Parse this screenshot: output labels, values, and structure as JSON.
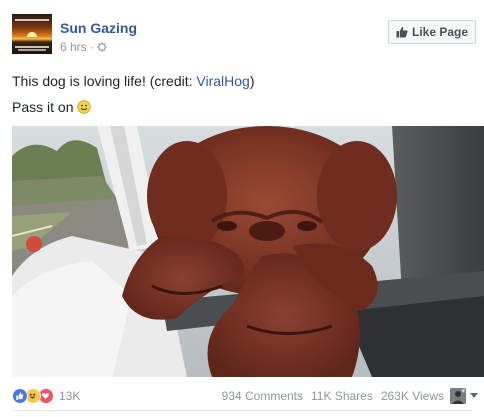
{
  "post": {
    "page_name": "Sun Gazing",
    "time": "6 hrs",
    "separator": "·",
    "like_page_label": "Like Page",
    "text_line1": "This dog is loving life! (credit: ",
    "text_link": "ViralHog",
    "text_line1_end": ")",
    "text_line2": "Pass it on"
  },
  "footer": {
    "reaction_count": "13K",
    "comments": "934 Comments",
    "shares": "11K Shares",
    "views": "263K Views"
  },
  "colors": {
    "link": "#365899",
    "meta": "#90949c",
    "like_reaction": "#4a76e8",
    "haha_reaction": "#f7c94b",
    "love_reaction": "#f25268"
  },
  "icons": [
    "globe-icon",
    "thumbs-up-icon",
    "smiley-icon",
    "like-reaction-icon",
    "haha-reaction-icon",
    "love-reaction-icon",
    "caret-down-icon"
  ]
}
